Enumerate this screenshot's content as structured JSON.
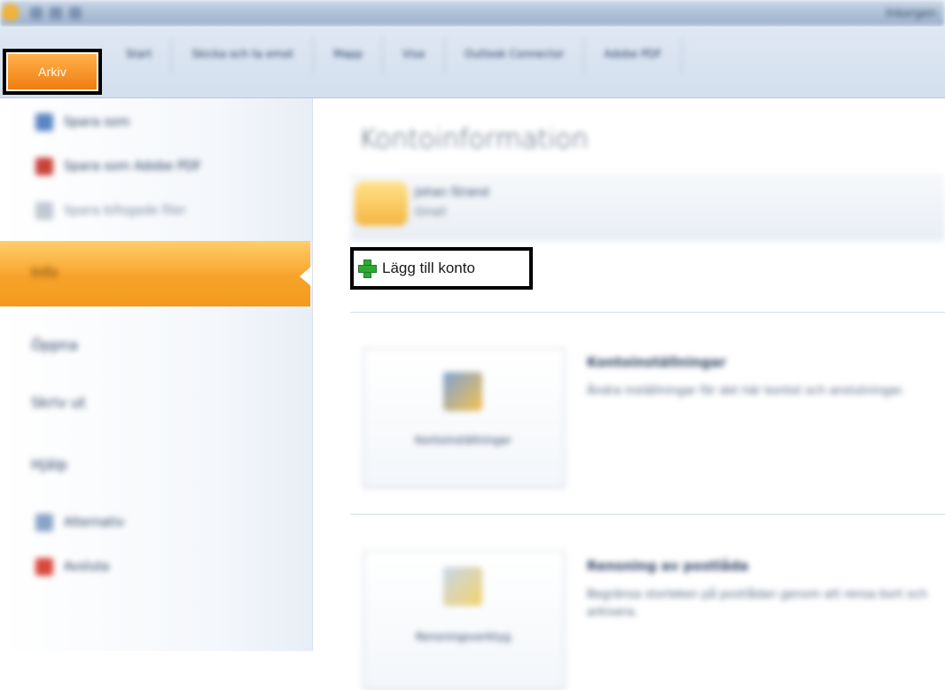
{
  "titlebar": {
    "caption": "Inkorgen"
  },
  "ribbon": {
    "file_tab": "Arkiv",
    "tabs": [
      "Start",
      "Skicka och ta emot",
      "Mapp",
      "Visa",
      "Outlook Connector",
      "Adobe PDF"
    ]
  },
  "sidebar": {
    "top_items": [
      {
        "label": "Spara som",
        "icon": "save-as-icon"
      },
      {
        "label": "Spara som Adobe PDF",
        "icon": "pdf-icon"
      },
      {
        "label": "Spara bifogade filer",
        "icon": "attachment-icon"
      }
    ],
    "info_label": "Info",
    "nav_items": [
      "Öppna",
      "Skriv ut",
      "Hjälp"
    ],
    "bottom_items": [
      {
        "label": "Alternativ",
        "icon": "options-icon"
      },
      {
        "label": "Avsluta",
        "icon": "exit-icon"
      }
    ]
  },
  "main": {
    "title": "Kontoinformation",
    "account_name": "Johan Strand",
    "account_type": "Gmail",
    "add_account_label": "Lägg till konto",
    "sections": [
      {
        "button_label": "Kontoinställningar",
        "title": "Kontoinställningar",
        "description": "Ändra inställningar för det här kontot och anslutningar."
      },
      {
        "button_label": "Rensningsverktyg",
        "title": "Rensning av postlåda",
        "description": "Begränsa storleken på postlådan genom att rensa bort och arkivera."
      }
    ]
  },
  "colors": {
    "accent_orange": "#f39a1c",
    "plus_green": "#2fa834"
  }
}
